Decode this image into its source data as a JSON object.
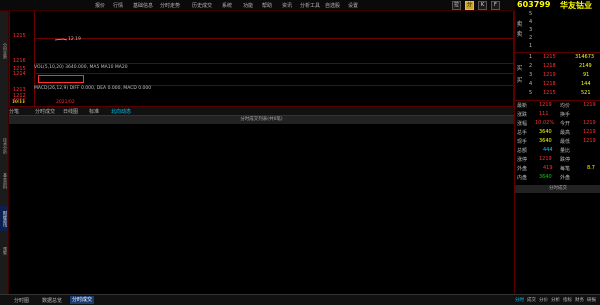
{
  "toolbar": {
    "menus": [
      "报价",
      "行情",
      "基础信息",
      "分时走势",
      "历史成交",
      "系统",
      "功能",
      "帮助",
      "资讯",
      "分析工具",
      "自选股",
      "设置"
    ],
    "buttons": [
      "拉",
      "分",
      "K",
      "F"
    ]
  },
  "stock": {
    "code": "603799",
    "name": "华友钴业"
  },
  "left_tabs": [
    "分时走势",
    "技术分析",
    "基本资料",
    "财经资讯",
    "预警"
  ],
  "chart": {
    "price_labels": [
      "1215",
      "1216",
      "1215",
      "1214",
      "1213",
      "1212",
      "1211"
    ],
    "ma_line_label": "12.19",
    "vol_label": "VOL(5,10,20) 3640.000, MA5 MA10 MA20",
    "macd_label": "MACD(26,12,9) DIFF 0.000, DEA 0.000, MACD 0.000",
    "bottom_value": "3640",
    "time_label": "10:11",
    "date_label": "2021/02"
  },
  "tabs": [
    "分笔",
    "分时成交",
    "日线图",
    "标准",
    "北向动态"
  ],
  "list_header": "分时成交列表(共0笔)",
  "orderbook": {
    "side_labels": {
      "sell": "卖",
      "buy": "买"
    },
    "sell": [
      {
        "level": "5",
        "price": "",
        "vol": ""
      },
      {
        "level": "4",
        "price": "",
        "vol": ""
      },
      {
        "level": "3",
        "price": "",
        "vol": ""
      },
      {
        "level": "2",
        "price": "",
        "vol": ""
      },
      {
        "level": "1",
        "price": "",
        "vol": ""
      }
    ],
    "buy": [
      {
        "level": "1",
        "price": "1215",
        "vol": "314673"
      },
      {
        "level": "2",
        "price": "1218",
        "vol": "2149"
      },
      {
        "level": "3",
        "price": "1219",
        "vol": "91"
      },
      {
        "level": "4",
        "price": "1218",
        "vol": "144"
      },
      {
        "level": "5",
        "price": "1215",
        "vol": "521"
      }
    ]
  },
  "stats": [
    {
      "l": "最新",
      "v": "1219",
      "l2": "均价",
      "v2": "1219"
    },
    {
      "l": "涨跌",
      "v": "111",
      "l2": "换手",
      "v2": ""
    },
    {
      "l": "涨幅",
      "v": "10.02%",
      "l2": "今开",
      "v2": "1219"
    },
    {
      "l": "总手",
      "v": "3640",
      "l2": "最高",
      "v2": "1219"
    },
    {
      "l": "现手",
      "v": "3640",
      "l2": "最低",
      "v2": "1219"
    },
    {
      "l": "总额",
      "v": "444",
      "l2": "量比",
      "v2": ""
    },
    {
      "l": "涨停",
      "v": "1219",
      "l2": "跌停",
      "v2": ""
    },
    {
      "l": "外盘",
      "v": "419",
      "l2": "每笔",
      "v2": "8.7"
    },
    {
      "l": "内盘",
      "v": "3640",
      "l2": "外盘",
      "v2": ""
    }
  ],
  "right_list_header": "分时成交",
  "bottom_tabs": [
    "分时图",
    "数据总览",
    "分时成交"
  ],
  "right_bottom_tabs": [
    "分时",
    "成交",
    "分价",
    "分析",
    "指标",
    "财务",
    "研报"
  ],
  "colors": {
    "up": "#ff3030",
    "down": "#00cc00",
    "accent": "#ffff00",
    "grid": "#6a0000"
  }
}
